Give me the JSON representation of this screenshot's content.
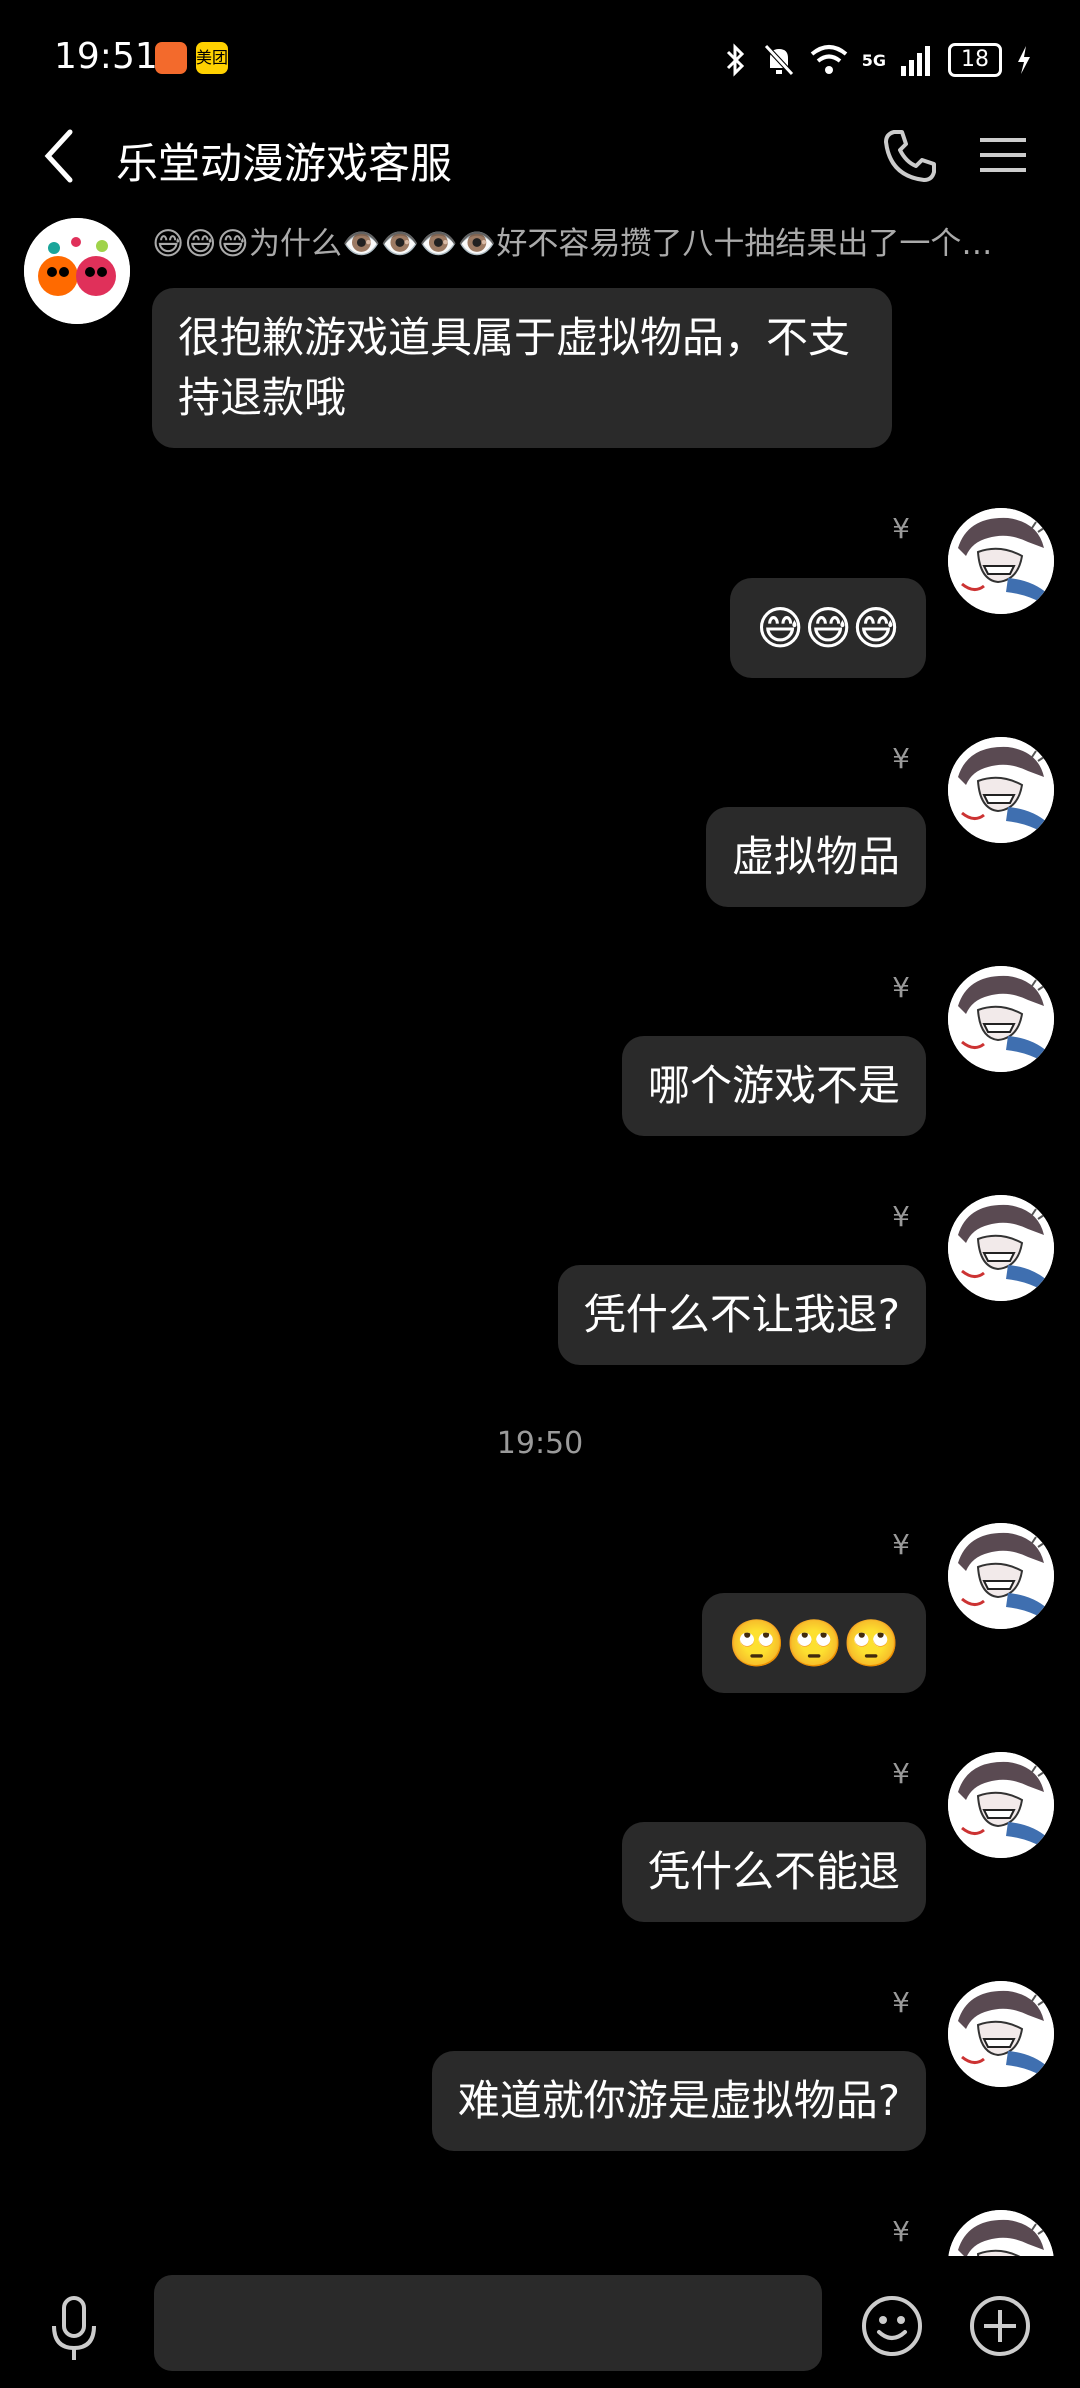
{
  "status_bar": {
    "time": "19:51",
    "app_icons": [
      "taobao-heart-icon",
      "meituan-icon"
    ],
    "meituan_label": "美团",
    "network": "5G",
    "battery": "18"
  },
  "header": {
    "title": "乐堂动漫游戏客服",
    "back_icon": "chevron-left-icon",
    "call_icon": "phone-icon",
    "menu_icon": "hamburger-menu-icon"
  },
  "preview_text": "😅😅😅为什么👁️👁️👁️👁️好不容易攒了八十抽结果出了一个…",
  "messages": [
    {
      "side": "left",
      "text": "很抱歉游戏道具属于虚拟物品，不支持退款哦"
    },
    {
      "side": "right",
      "tag": "¥",
      "text": "😅😅😅"
    },
    {
      "side": "right",
      "tag": "¥",
      "text": "虚拟物品"
    },
    {
      "side": "right",
      "tag": "¥",
      "text": "哪个游戏不是"
    },
    {
      "side": "right",
      "tag": "¥",
      "text": "凭什么不让我退?"
    },
    {
      "side": "right",
      "tag": "¥",
      "text": "🙄🙄🙄"
    },
    {
      "side": "right",
      "tag": "¥",
      "text": "凭什么不能退"
    },
    {
      "side": "right",
      "tag": "¥",
      "text": "难道就你游是虚拟物品?"
    },
    {
      "side": "right",
      "tag": "¥",
      "text": ""
    }
  ],
  "timestamp": "19:50",
  "input": {
    "placeholder": "",
    "mic_icon": "microphone-icon",
    "emoji_icon": "smiley-icon",
    "plus_icon": "plus-circle-icon"
  },
  "colors": {
    "background": "#000000",
    "bubble": "#2a2a2a",
    "muted_text": "#9a9a9a"
  }
}
